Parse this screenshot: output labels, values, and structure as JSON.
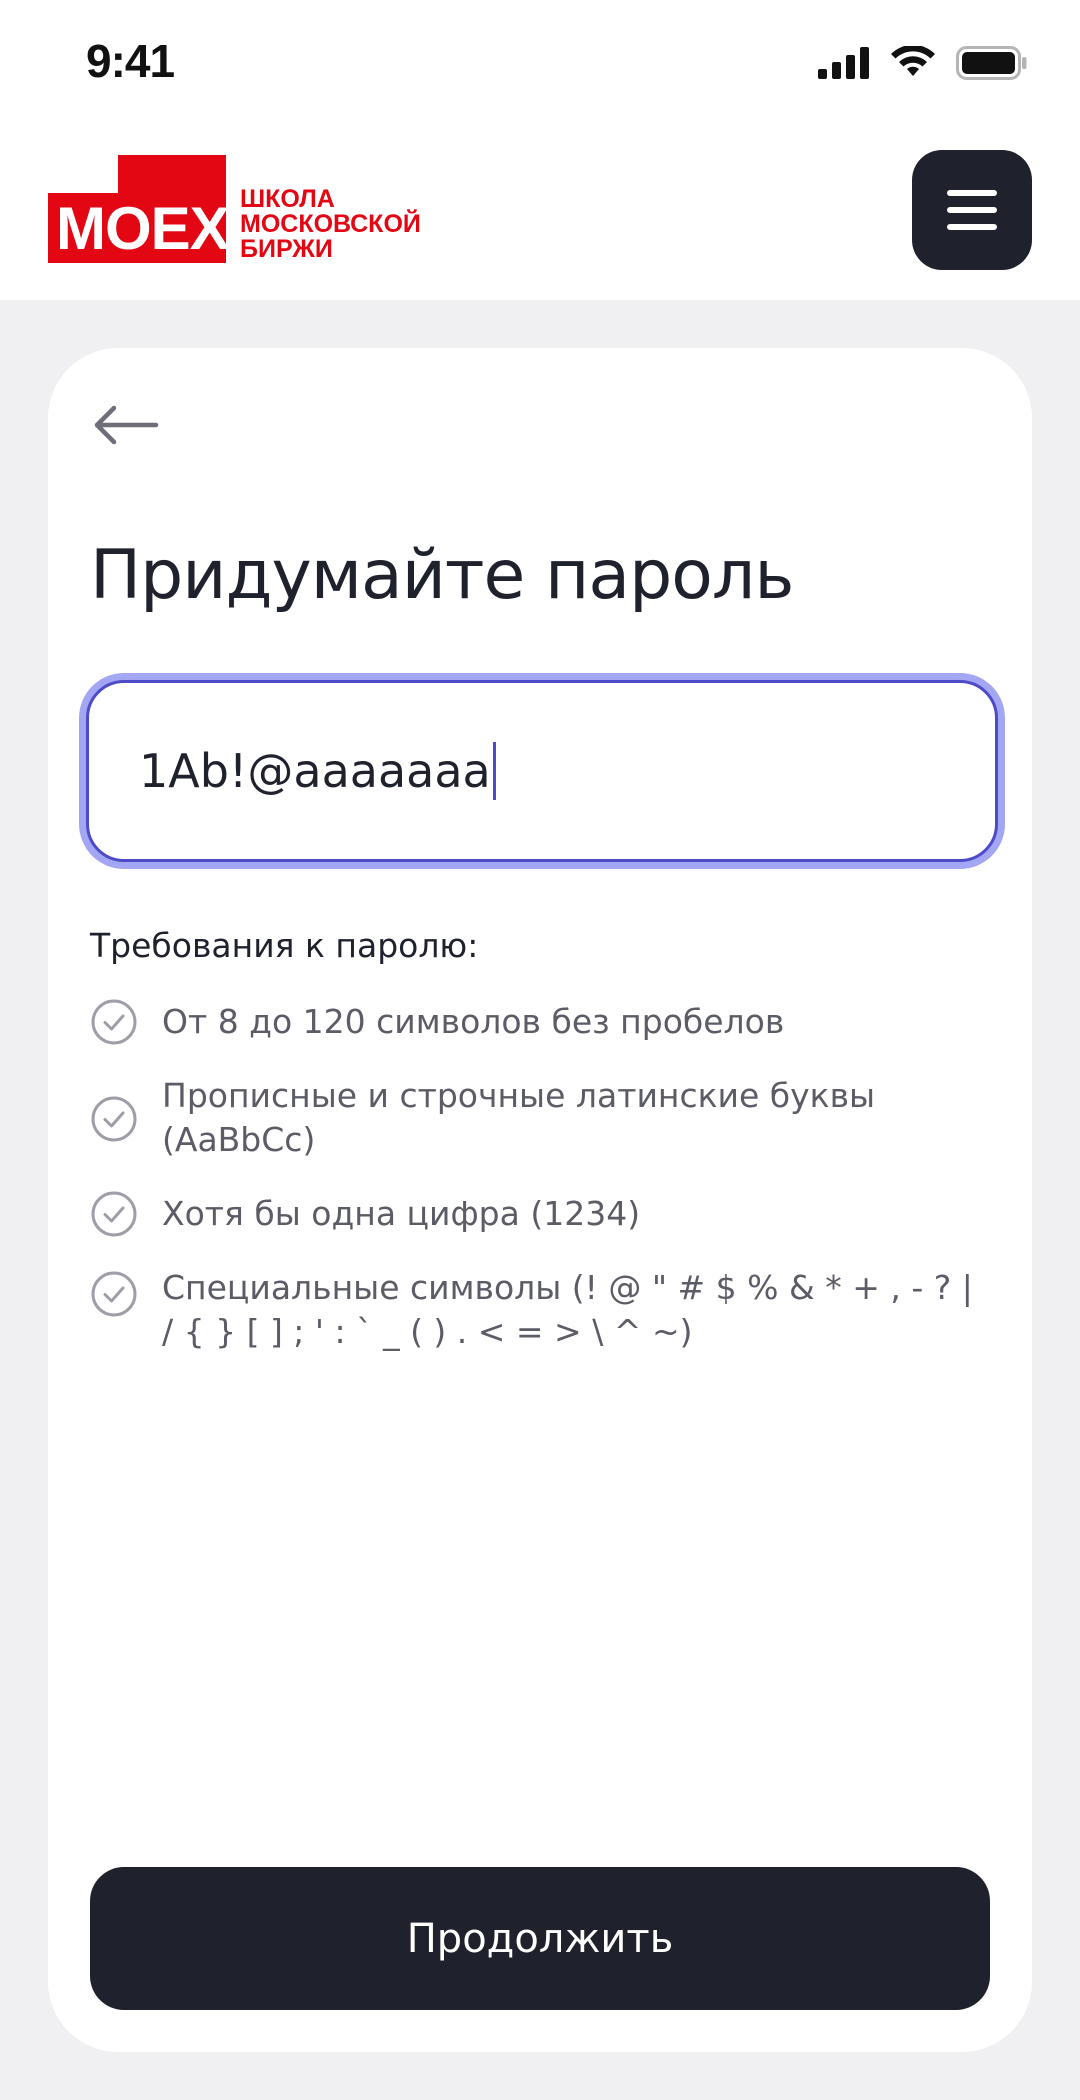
{
  "status_bar": {
    "time": "9:41"
  },
  "header": {
    "logo_moex": "MOEX",
    "logo_lines": [
      "ШКОЛА",
      "МОСКОВСКОЙ",
      "БИРЖИ"
    ]
  },
  "page": {
    "title": "Придумайте пароль",
    "password_value": "1Ab!@aaaaaaa",
    "requirements_title": "Требования к паролю:",
    "requirements": [
      {
        "text": "От 8 до 120 символов без пробелов",
        "met": true
      },
      {
        "text": "Прописные и строчные латинские буквы (AaBbCc)",
        "met": true
      },
      {
        "text": "Хотя бы одна цифра (1234)",
        "met": true
      },
      {
        "text": "Специальные символы (! @ \" # $ % & * + , - ? | / { } [ ] ; ' : ` _ ( ) . < = > \\ ^ ~)",
        "met": true
      }
    ],
    "continue_label": "Продолжить"
  },
  "colors": {
    "accent": "#4e4bc8",
    "focus_ring": "#a3a6f3",
    "brand_red": "#e30613",
    "dark": "#1f222c",
    "muted_text": "#5b5c66",
    "check_icon": "#9d9ea8"
  },
  "icons": {
    "back": "arrow-left-icon",
    "menu": "hamburger-icon",
    "check": "check-circle-icon",
    "signal": "cellular-signal-icon",
    "wifi": "wifi-icon",
    "battery": "battery-icon"
  }
}
